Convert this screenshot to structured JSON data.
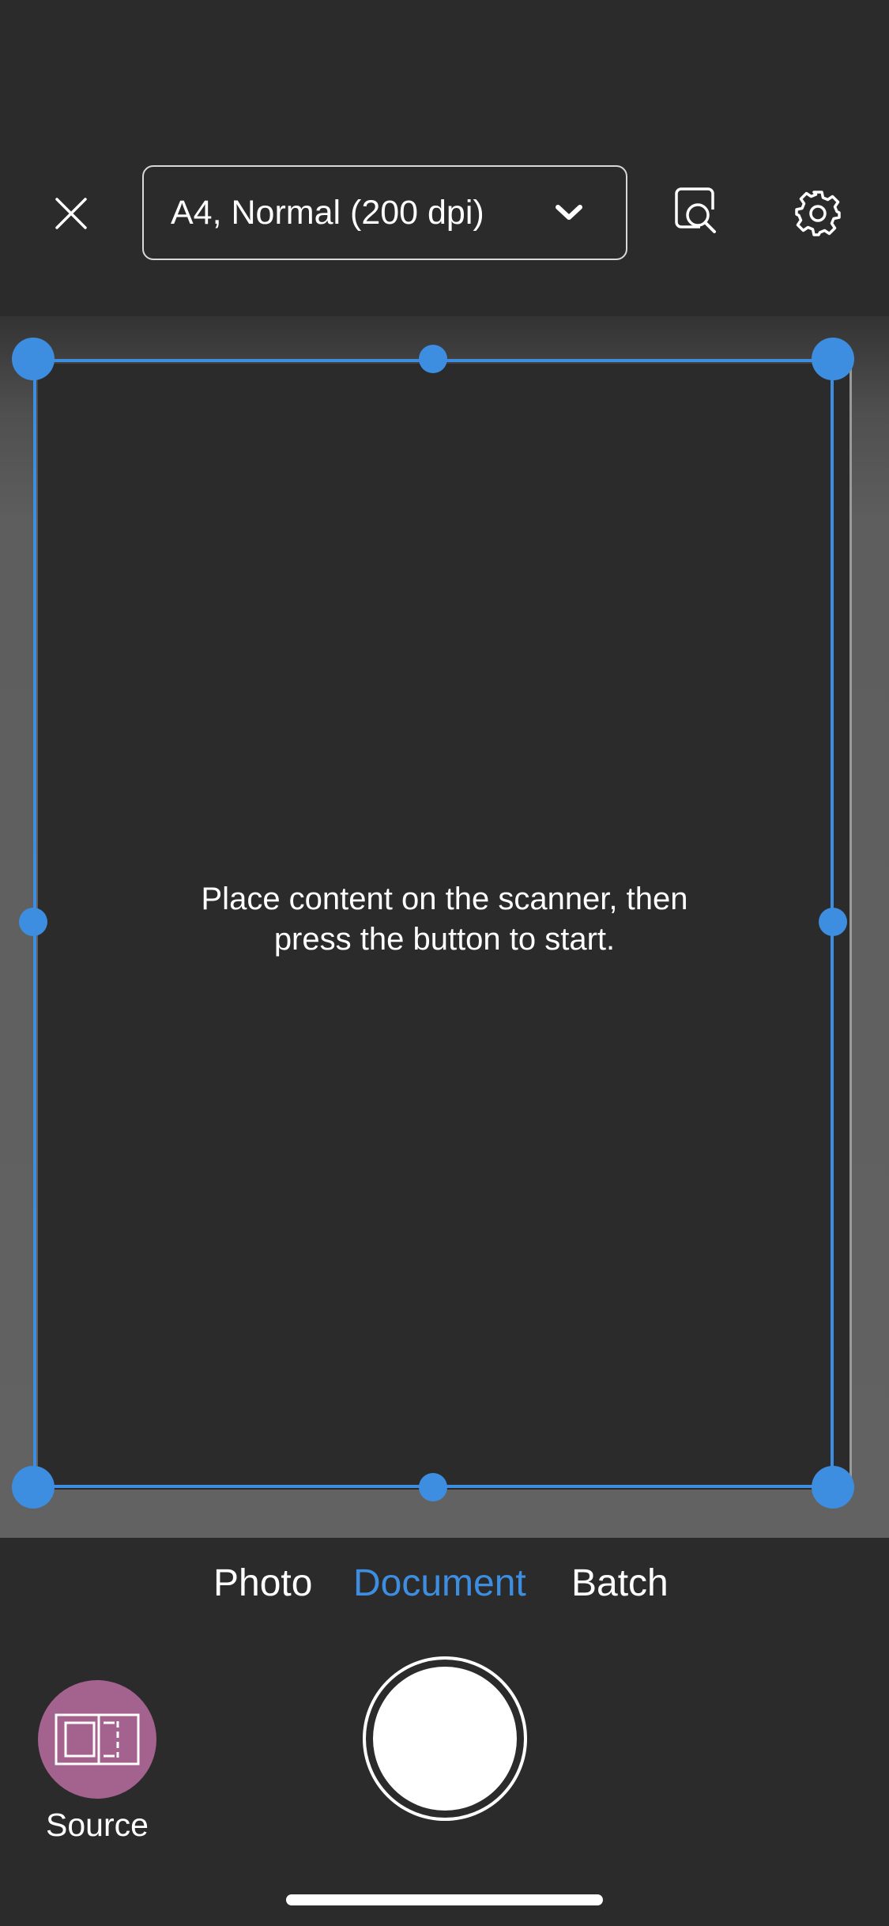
{
  "header": {
    "close_icon": "close-icon",
    "profile_label": "A4, Normal (200 dpi)",
    "dropdown_icon": "chevron-down-icon",
    "preview_icon": "document-search-icon",
    "settings_icon": "gear-icon"
  },
  "scan_area": {
    "instructions": "Place content on the scanner, then\npress the button to start."
  },
  "modes": {
    "tabs": [
      {
        "label": "Photo",
        "active": false
      },
      {
        "label": "Document",
        "active": true
      },
      {
        "label": "Batch",
        "active": false
      }
    ]
  },
  "source": {
    "label": "Source",
    "icon": "scanner-source-icon"
  },
  "colors": {
    "accent": "#3d8ee0",
    "source_button": "#a4628e",
    "background": "#2b2b2b"
  }
}
